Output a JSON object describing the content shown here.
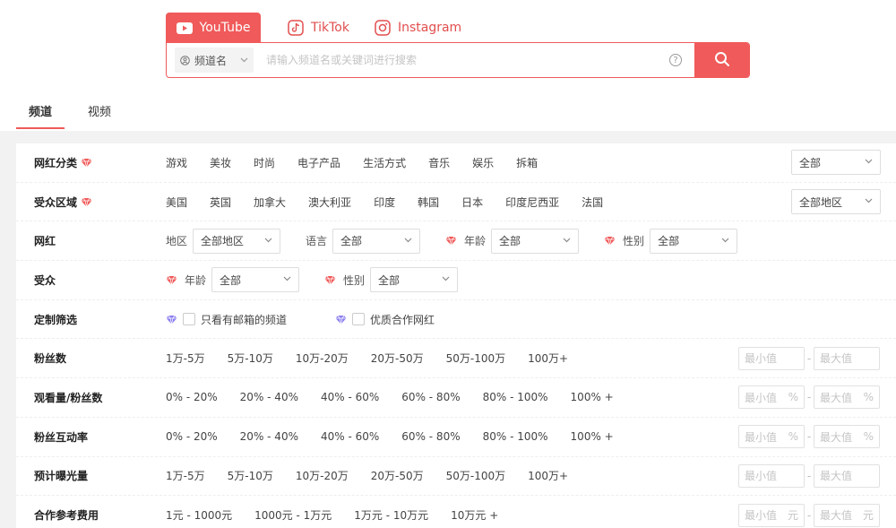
{
  "platforms": [
    {
      "label": "YouTube",
      "icon": "youtube-icon",
      "active": true
    },
    {
      "label": "TikTok",
      "icon": "tiktok-icon",
      "active": false
    },
    {
      "label": "Instagram",
      "icon": "instagram-icon",
      "active": false
    }
  ],
  "search": {
    "type_label": "频道名",
    "placeholder": "请输入频道名或关键词进行搜索",
    "help": "?"
  },
  "content_tabs": [
    "频道",
    "视频"
  ],
  "filters": {
    "category": {
      "label": "网红分类",
      "options": [
        "游戏",
        "美妆",
        "时尚",
        "电子产品",
        "生活方式",
        "音乐",
        "娱乐",
        "拆箱"
      ],
      "select": "全部"
    },
    "audience_region": {
      "label": "受众区域",
      "options": [
        "美国",
        "英国",
        "加拿大",
        "澳大利亚",
        "印度",
        "韩国",
        "日本",
        "印度尼西亚",
        "法国"
      ],
      "select": "全部地区"
    },
    "influencer": {
      "label": "网红",
      "region_label": "地区",
      "region_value": "全部地区",
      "lang_label": "语言",
      "lang_value": "全部",
      "age_label": "年龄",
      "age_value": "全部",
      "gender_label": "性别",
      "gender_value": "全部"
    },
    "audience": {
      "label": "受众",
      "age_label": "年龄",
      "age_value": "全部",
      "gender_label": "性别",
      "gender_value": "全部"
    },
    "custom": {
      "label": "定制筛选",
      "check1": "只看有邮箱的频道",
      "check2": "优质合作网红"
    },
    "followers": {
      "label": "粉丝数",
      "options": [
        "1万-5万",
        "5万-10万",
        "10万-20万",
        "20万-50万",
        "50万-100万",
        "100万+"
      ],
      "min": "最小值",
      "max": "最大值",
      "unit": ""
    },
    "view_ratio": {
      "label": "观看量/粉丝数",
      "options": [
        "0% - 20%",
        "20% - 40%",
        "40% - 60%",
        "60% - 80%",
        "80% - 100%",
        "100% +"
      ],
      "min": "最小值",
      "max": "最大值",
      "unit": "%"
    },
    "engagement": {
      "label": "粉丝互动率",
      "options": [
        "0% - 20%",
        "20% - 40%",
        "40% - 60%",
        "60% - 80%",
        "80% - 100%",
        "100% +"
      ],
      "min": "最小值",
      "max": "最大值",
      "unit": "%"
    },
    "exposure": {
      "label": "预计曝光量",
      "options": [
        "1万-5万",
        "5万-10万",
        "10万-20万",
        "20万-50万",
        "50万-100万",
        "100万+"
      ],
      "min": "最小值",
      "max": "最大值",
      "unit": ""
    },
    "cost": {
      "label": "合作参考费用",
      "options": [
        "1元 - 1000元",
        "1000元 - 1万元",
        "1万元 - 10万元",
        "10万元 +"
      ],
      "min": "最小值",
      "max": "最大值",
      "unit": "元"
    }
  },
  "colors": {
    "accent": "#f05a5a",
    "gem_red": "#f05a5a",
    "gem_purple": "#8b7ff0"
  }
}
